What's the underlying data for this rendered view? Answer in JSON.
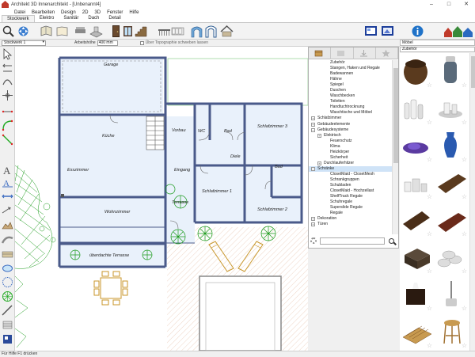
{
  "window": {
    "title": "Architekt 3D Innenarchitekt - [Unbenannt4]",
    "min": "–",
    "max": "□",
    "close": "✕"
  },
  "menu": [
    "Datei",
    "Bearbeiten",
    "Design",
    "2D",
    "3D",
    "Fenster",
    "Hilfe"
  ],
  "ribbon_tabs": [
    "Stockwerk",
    "Elektro",
    "Sanitär",
    "Dach",
    "Detail"
  ],
  "propbar": {
    "floor": "Stockwerk 1",
    "height_label": "Arbeitshöhe",
    "height_value": "400 mm",
    "topo_label": "Über Topographie schweben lassen"
  },
  "plan": {
    "rooms": {
      "garage": "Garage",
      "kueche": "Küche",
      "vorbau": "Vorbau",
      "wc": "WC",
      "bad1": "Bad",
      "schlafzimmer3": "Schlafzimmer 3",
      "diele": "Diele",
      "bad2": "Bad",
      "esszimmer": "Esszimmer",
      "eingang": "Eingang",
      "schlafzimmer1": "Schlafzimmer 1",
      "wohnzimmer": "Wohnzimmer",
      "terrasse": "Terrasse",
      "schlafzimmer2": "Schlafzimmer 2",
      "ueberdachte": "überdachte Terrasse"
    }
  },
  "tree": {
    "items": [
      {
        "label": "Zubehör",
        "indent": 2
      },
      {
        "label": "Stangen, Haken und Regale",
        "indent": 2
      },
      {
        "label": "Badewannen",
        "indent": 2
      },
      {
        "label": "Hähne",
        "indent": 2
      },
      {
        "label": "Spiegel",
        "indent": 2
      },
      {
        "label": "Duschen",
        "indent": 2
      },
      {
        "label": "Waschbecken",
        "indent": 2
      },
      {
        "label": "Toiletten",
        "indent": 2
      },
      {
        "label": "Handtuchtrocknung",
        "indent": 2
      },
      {
        "label": "Waschtische und Möbel",
        "indent": 2
      },
      {
        "label": "Schlafzimmer",
        "indent": 0,
        "exp": "+"
      },
      {
        "label": "Gebäudeelemente",
        "indent": 0,
        "exp": "+"
      },
      {
        "label": "Gebäudesysteme",
        "indent": 0,
        "exp": "-"
      },
      {
        "label": "Elektrisch",
        "indent": 1,
        "exp": "+"
      },
      {
        "label": "Feuerschutz",
        "indent": 2
      },
      {
        "label": "Klima",
        "indent": 2
      },
      {
        "label": "Heizkörper",
        "indent": 2
      },
      {
        "label": "Sicherheit",
        "indent": 2
      },
      {
        "label": "Durchlauferhitzer",
        "indent": 1,
        "exp": "+"
      },
      {
        "label": "Schränke",
        "indent": 0,
        "exp": "-",
        "sel": true
      },
      {
        "label": "ClosetMaid - ClosetMesh",
        "indent": 2
      },
      {
        "label": "Schrankgruppen",
        "indent": 2
      },
      {
        "label": "Schubladen",
        "indent": 2
      },
      {
        "label": "ClosetMaid - Hochzellast",
        "indent": 2
      },
      {
        "label": "ShelfTrack Regale",
        "indent": 2
      },
      {
        "label": "Schuhregale",
        "indent": 2
      },
      {
        "label": "Superslide Regale",
        "indent": 2
      },
      {
        "label": "Regale",
        "indent": 2
      },
      {
        "label": "Dekoration",
        "indent": 0,
        "exp": "+"
      },
      {
        "label": "Türen",
        "indent": 0,
        "exp": "+"
      }
    ]
  },
  "catalog": {
    "header": "Möbel",
    "category": "Zubehör",
    "star": "☆"
  },
  "status": "Für Hilfe F1 drücken",
  "colors": {
    "wall": "#4a5a8a",
    "room_fill": "#e9f1fb",
    "plant": "#1a9a1a",
    "furniture": "#c8962a",
    "selection": "#cfe3f7"
  }
}
